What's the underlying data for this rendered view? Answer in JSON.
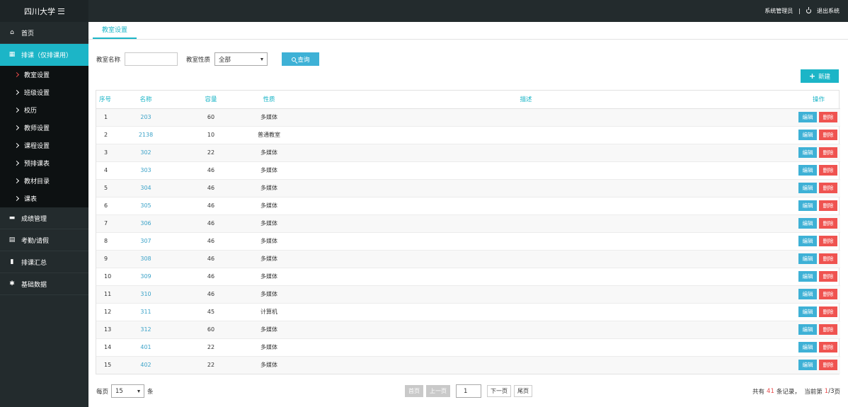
{
  "sidebar": {
    "brand": "四川大学",
    "items": [
      {
        "label": "首页",
        "icon": "home-icon",
        "glyph": "⌂"
      },
      {
        "label": "排课（仅排课用）",
        "icon": "grid-icon",
        "glyph": "▦"
      },
      {
        "label": "成绩管理",
        "icon": "folder-icon",
        "glyph": "▬"
      },
      {
        "label": "考勤/请假",
        "icon": "list-icon",
        "glyph": "▤"
      },
      {
        "label": "排课汇总",
        "icon": "bar-chart-icon",
        "glyph": "▮"
      },
      {
        "label": "基础数据",
        "icon": "gear-icon",
        "glyph": "✱"
      }
    ],
    "subitems": [
      "教室设置",
      "班级设置",
      "校历",
      "教师设置",
      "课程设置",
      "预排课表",
      "教材目录",
      "课表"
    ]
  },
  "topbar": {
    "user": "系统管理员",
    "separator": "|",
    "logout": "退出系统"
  },
  "tabs": [
    {
      "label": "教室设置"
    }
  ],
  "filters": {
    "name_label": "教室名称",
    "name_value": "",
    "type_label": "教室性质",
    "type_value": "全部",
    "query_label": "查询"
  },
  "new_label": "新建",
  "table": {
    "headers": [
      "序号",
      "名称",
      "容量",
      "性质",
      "描述",
      "操作"
    ],
    "rows": [
      {
        "no": "1",
        "name": "203",
        "cap": "60",
        "kind": "多媒体",
        "desc": ""
      },
      {
        "no": "2",
        "name": "2138",
        "cap": "10",
        "kind": "普通教室",
        "desc": ""
      },
      {
        "no": "3",
        "name": "302",
        "cap": "22",
        "kind": "多媒体",
        "desc": ""
      },
      {
        "no": "4",
        "name": "303",
        "cap": "46",
        "kind": "多媒体",
        "desc": ""
      },
      {
        "no": "5",
        "name": "304",
        "cap": "46",
        "kind": "多媒体",
        "desc": ""
      },
      {
        "no": "6",
        "name": "305",
        "cap": "46",
        "kind": "多媒体",
        "desc": ""
      },
      {
        "no": "7",
        "name": "306",
        "cap": "46",
        "kind": "多媒体",
        "desc": ""
      },
      {
        "no": "8",
        "name": "307",
        "cap": "46",
        "kind": "多媒体",
        "desc": ""
      },
      {
        "no": "9",
        "name": "308",
        "cap": "46",
        "kind": "多媒体",
        "desc": ""
      },
      {
        "no": "10",
        "name": "309",
        "cap": "46",
        "kind": "多媒体",
        "desc": ""
      },
      {
        "no": "11",
        "name": "310",
        "cap": "46",
        "kind": "多媒体",
        "desc": ""
      },
      {
        "no": "12",
        "name": "311",
        "cap": "45",
        "kind": "计算机",
        "desc": ""
      },
      {
        "no": "13",
        "name": "312",
        "cap": "60",
        "kind": "多媒体",
        "desc": ""
      },
      {
        "no": "14",
        "name": "401",
        "cap": "22",
        "kind": "多媒体",
        "desc": ""
      },
      {
        "no": "15",
        "name": "402",
        "cap": "22",
        "kind": "多媒体",
        "desc": ""
      }
    ],
    "edit_label": "编辑",
    "delete_label": "删除"
  },
  "footer": {
    "per_page_prefix": "每页",
    "per_page_value": "15",
    "per_page_suffix": "条",
    "first": "首页",
    "prev": "上一页",
    "page_input": "1",
    "next": "下一页",
    "last": "尾页",
    "total_prefix": "共有",
    "total_count": "41",
    "total_mid": "条记录，  当前第",
    "current_page": "1",
    "total_pages": "/3",
    "total_suffix": "页"
  },
  "colors": {
    "accent": "#1cb5c7",
    "sidebar_bg": "#232b2d",
    "submenu_bg": "#0d1112",
    "edit_button": "#3eb1d6",
    "delete_button": "#ef5350",
    "highlight": "#e84a4a"
  }
}
